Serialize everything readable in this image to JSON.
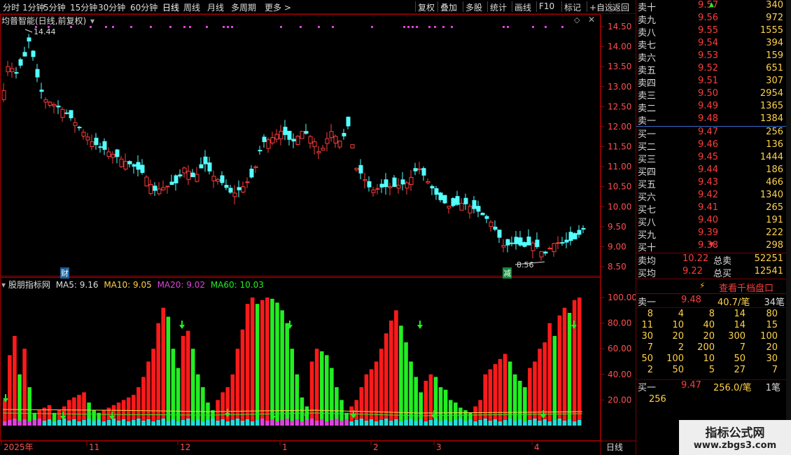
{
  "toolbar": {
    "periods": [
      "分时",
      "1分钟",
      "5分钟",
      "15分钟",
      "30分钟",
      "60分钟",
      "日线",
      "周线",
      "月线",
      "多周期",
      "更多 >"
    ],
    "active_period": "日线",
    "actions": [
      "复权",
      "叠加",
      "多股",
      "统计",
      "画线",
      "F10",
      "标记",
      "+自选",
      "返回"
    ]
  },
  "chart_header": {
    "title": "均普智能(日线,前复权)",
    "high_label": "14.44",
    "low_label": "8.56",
    "badge_cai": "财",
    "badge_jian": "减"
  },
  "price_axis": {
    "ticks": [
      "14.50",
      "14.00",
      "13.50",
      "13.00",
      "12.50",
      "12.00",
      "11.50",
      "11.00",
      "10.50",
      "10.00",
      "9.50",
      "9.00",
      "8.50"
    ]
  },
  "indicator": {
    "name": "股朋指标网",
    "ma5_label": "MA5: 9.16",
    "ma10_label": "MA10: 9.05",
    "ma20_label": "MA20: 9.02",
    "ma60_label": "MA60: 10.03",
    "ticks": [
      "100.00",
      "80.00",
      "60.00",
      "40.00",
      "20.00"
    ]
  },
  "date_axis": {
    "labels": [
      "2025年",
      "11",
      "12",
      "1",
      "2",
      "3",
      "4"
    ],
    "period_label": "日线"
  },
  "order_book": {
    "asks": [
      {
        "label": "卖十",
        "price": "9.57",
        "vol": "340"
      },
      {
        "label": "卖九",
        "price": "9.56",
        "vol": "972"
      },
      {
        "label": "卖八",
        "price": "9.55",
        "vol": "1555"
      },
      {
        "label": "卖七",
        "price": "9.54",
        "vol": "394"
      },
      {
        "label": "卖六",
        "price": "9.53",
        "vol": "159"
      },
      {
        "label": "卖五",
        "price": "9.52",
        "vol": "651"
      },
      {
        "label": "卖四",
        "price": "9.51",
        "vol": "307"
      },
      {
        "label": "卖三",
        "price": "9.50",
        "vol": "2954"
      },
      {
        "label": "卖二",
        "price": "9.49",
        "vol": "1365"
      },
      {
        "label": "卖一",
        "price": "9.48",
        "vol": "1384"
      }
    ],
    "bids": [
      {
        "label": "买一",
        "price": "9.47",
        "vol": "256"
      },
      {
        "label": "买二",
        "price": "9.46",
        "vol": "136"
      },
      {
        "label": "买三",
        "price": "9.45",
        "vol": "1444"
      },
      {
        "label": "买四",
        "price": "9.44",
        "vol": "186"
      },
      {
        "label": "买五",
        "price": "9.43",
        "vol": "466"
      },
      {
        "label": "买六",
        "price": "9.42",
        "vol": "1340"
      },
      {
        "label": "买七",
        "price": "9.41",
        "vol": "265"
      },
      {
        "label": "买八",
        "price": "9.40",
        "vol": "191"
      },
      {
        "label": "买九",
        "price": "9.39",
        "vol": "222"
      },
      {
        "label": "买十",
        "price": "9.38",
        "vol": "298"
      }
    ],
    "sell_avg_label": "卖均",
    "sell_avg": "10.22",
    "sell_total_label": "总卖",
    "sell_total": "52251",
    "buy_avg_label": "买均",
    "buy_avg": "9.22",
    "buy_total_label": "总买",
    "buy_total": "12541",
    "thousand_btn": "查看千档盘口",
    "sell1_label": "卖一",
    "sell1_price": "9.48",
    "sell1_avg": "40.7/笔",
    "sell1_count": "34笔",
    "sell1_queue": [
      "8",
      "4",
      "8",
      "14",
      "80",
      "11",
      "10",
      "40",
      "14",
      "15",
      "30",
      "20",
      "20",
      "300",
      "100",
      "7",
      "2",
      "200",
      "7",
      "20",
      "50",
      "100",
      "10",
      "50",
      "30",
      "2",
      "50",
      "5",
      "27",
      "7"
    ],
    "buy1_label": "买一",
    "buy1_price": "9.47",
    "buy1_avg": "256.0/笔",
    "buy1_count": "1笔",
    "buy1_queue": [
      "256"
    ]
  },
  "watermark": {
    "line1": "指标公式网",
    "line2": "www.zbgs3.com"
  },
  "colors": {
    "up": "#ff3c3c",
    "down": "#54ffff",
    "bar_red": "#ff1a1a",
    "bar_green": "#22ee22",
    "bar_cyan": "#22dddd",
    "bar_magenta": "#e040e0"
  }
}
